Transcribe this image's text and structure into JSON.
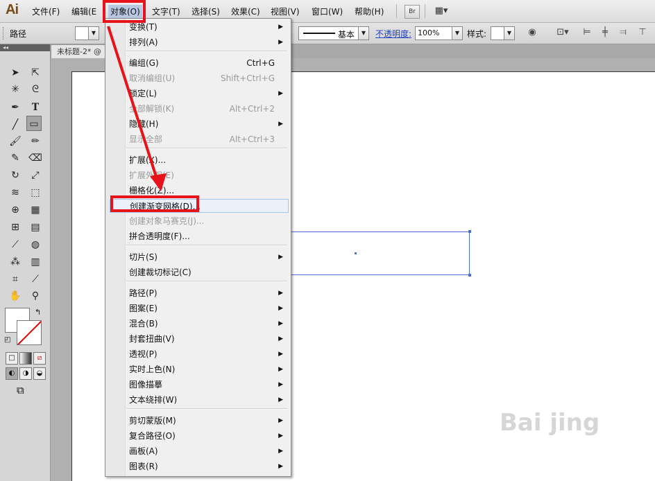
{
  "app": {
    "logo": "Ai"
  },
  "menubar": {
    "items": [
      "文件(F)",
      "编辑(E",
      "对象(O)",
      "文字(T)",
      "选择(S)",
      "效果(C)",
      "视图(V)",
      "窗口(W)",
      "帮助(H)"
    ],
    "br_label": "Br",
    "layout_icon": "grid-layout-icon"
  },
  "control": {
    "path_label": "路径",
    "stroke_style": "基本",
    "opacity_label": "不透明度:",
    "opacity_value": "100%",
    "style_label": "样式:"
  },
  "document": {
    "tab_title": "未标题-2* @"
  },
  "object_menu": {
    "items": [
      {
        "label": "变换(T)",
        "shortcut": "",
        "submenu": true,
        "disabled": false
      },
      {
        "label": "排列(A)",
        "shortcut": "",
        "submenu": true,
        "disabled": false
      },
      {
        "label": "编组(G)",
        "shortcut": "Ctrl+G",
        "submenu": false,
        "disabled": false
      },
      {
        "label": "取消编组(U)",
        "shortcut": "Shift+Ctrl+G",
        "submenu": false,
        "disabled": true
      },
      {
        "label": "锁定(L)",
        "shortcut": "",
        "submenu": true,
        "disabled": false
      },
      {
        "label": "全部解锁(K)",
        "shortcut": "Alt+Ctrl+2",
        "submenu": false,
        "disabled": true
      },
      {
        "label": "隐藏(H)",
        "shortcut": "",
        "submenu": true,
        "disabled": false
      },
      {
        "label": "显示全部",
        "shortcut": "Alt+Ctrl+3",
        "submenu": false,
        "disabled": true
      },
      {
        "label": "扩展(X)...",
        "shortcut": "",
        "submenu": false,
        "disabled": false
      },
      {
        "label": "扩展外观(E)",
        "shortcut": "",
        "submenu": false,
        "disabled": true
      },
      {
        "label": "栅格化(Z)...",
        "shortcut": "",
        "submenu": false,
        "disabled": false
      },
      {
        "label": "创建渐变网格(D)...",
        "shortcut": "",
        "submenu": false,
        "disabled": false,
        "highlighted": true
      },
      {
        "label": "创建对象马赛克(J)...",
        "shortcut": "",
        "submenu": false,
        "disabled": true
      },
      {
        "label": "拼合透明度(F)...",
        "shortcut": "",
        "submenu": false,
        "disabled": false
      },
      {
        "label": "切片(S)",
        "shortcut": "",
        "submenu": true,
        "disabled": false
      },
      {
        "label": "创建裁切标记(C)",
        "shortcut": "",
        "submenu": false,
        "disabled": false
      },
      {
        "label": "路径(P)",
        "shortcut": "",
        "submenu": true,
        "disabled": false
      },
      {
        "label": "图案(E)",
        "shortcut": "",
        "submenu": true,
        "disabled": false
      },
      {
        "label": "混合(B)",
        "shortcut": "",
        "submenu": true,
        "disabled": false
      },
      {
        "label": "封套扭曲(V)",
        "shortcut": "",
        "submenu": true,
        "disabled": false
      },
      {
        "label": "透视(P)",
        "shortcut": "",
        "submenu": true,
        "disabled": false
      },
      {
        "label": "实时上色(N)",
        "shortcut": "",
        "submenu": true,
        "disabled": false
      },
      {
        "label": "图像描摹",
        "shortcut": "",
        "submenu": true,
        "disabled": false
      },
      {
        "label": "文本绕排(W)",
        "shortcut": "",
        "submenu": true,
        "disabled": false
      },
      {
        "label": "剪切蒙版(M)",
        "shortcut": "",
        "submenu": true,
        "disabled": false
      },
      {
        "label": "复合路径(O)",
        "shortcut": "",
        "submenu": true,
        "disabled": false
      },
      {
        "label": "画板(A)",
        "shortcut": "",
        "submenu": true,
        "disabled": false
      },
      {
        "label": "图表(R)",
        "shortcut": "",
        "submenu": true,
        "disabled": false
      }
    ]
  },
  "colors": {
    "accent": "#e8121a",
    "selection": "#4a6fd4",
    "menu_highlight": "#eaf1fb"
  },
  "watermark": {
    "text": "Bai jing"
  }
}
